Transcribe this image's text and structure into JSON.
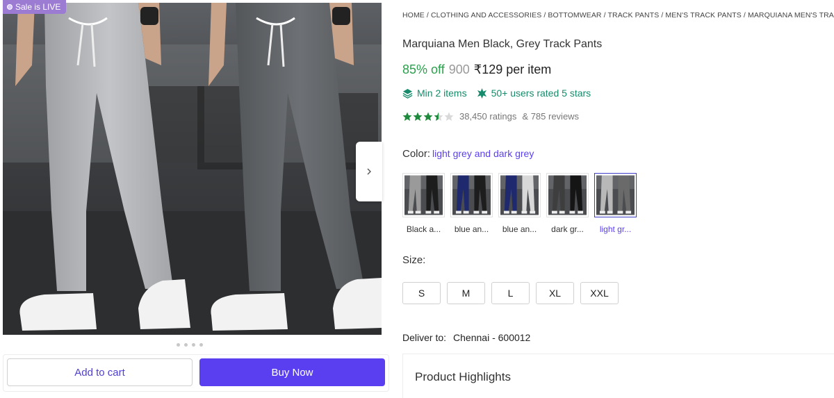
{
  "sale_badge": "Sale is LIVE",
  "breadcrumb": [
    "HOME",
    "CLOTHING AND ACCESSORIES",
    "BOTTOMWEAR",
    "TRACK PANTS",
    "MEN'S TRACK PANTS",
    "MARQUIANA MEN'S TRACK PANTS"
  ],
  "breadcrumb_sep": " / ",
  "product": {
    "title": "Marquiana Men Black, Grey Track Pants",
    "discount": "85% off",
    "mrp": "900",
    "price": "₹129 per item",
    "perk_min": "Min 2 items",
    "perk_rated": "50+ users rated 5 stars",
    "rating_value": 3.5,
    "ratings_text": "38,450 ratings",
    "reviews_text": "& 785 reviews"
  },
  "color": {
    "label": "Color:",
    "value": "light grey and dark grey",
    "options": [
      {
        "label": "Black a...",
        "left": "#9a9a9a",
        "right": "#1d1d1d"
      },
      {
        "label": "blue an...",
        "left": "#1f2a6e",
        "right": "#1d1d1d"
      },
      {
        "label": "blue an...",
        "left": "#1f2a6e",
        "right": "#d8d8d8"
      },
      {
        "label": "dark gr...",
        "left": "#3e3e3e",
        "right": "#151515"
      },
      {
        "label": "light gr...",
        "left": "#b8b8b8",
        "right": "#6a6a6a"
      }
    ],
    "selected_index": 4
  },
  "size": {
    "label": "Size:",
    "options": [
      "S",
      "M",
      "L",
      "XL",
      "XXL"
    ]
  },
  "deliver": {
    "label": "Deliver to:",
    "value": "Chennai - 600012"
  },
  "highlights_title": "Product Highlights",
  "buttons": {
    "add_to_cart": "Add to cart",
    "buy_now": "Buy Now"
  },
  "colors": {
    "accent": "#5a3ff0",
    "discount_green": "#29a04b",
    "perk_teal": "#168a6a",
    "star_green": "#1e8a3c",
    "sale_badge": "#9c7bd3"
  },
  "icons": {
    "next": "chevron-right-icon",
    "perk_min": "stack-layers-icon",
    "perk_rated": "star-burst-icon",
    "rating": "star-icon"
  },
  "image_dots": 4
}
